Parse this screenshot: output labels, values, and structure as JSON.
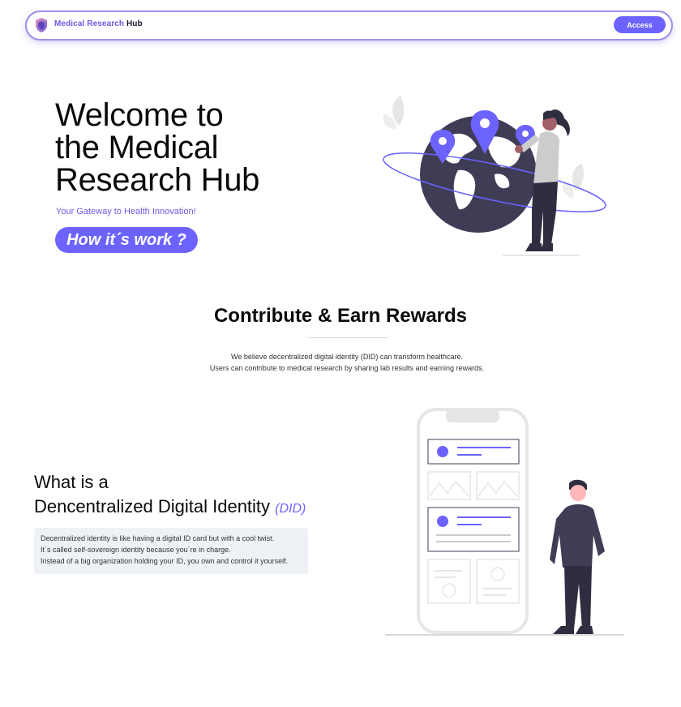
{
  "nav": {
    "brand_accent": "Medical Research",
    "brand_rest": " Hub",
    "access_label": "Access",
    "logo_icon": "shield-icon"
  },
  "hero": {
    "title_line1": "Welcome to",
    "title_line2": "the Medical",
    "title_line3": "Research Hub",
    "subtitle": "Your Gateway to Health Innovation!",
    "cta_label": "How it´s work ?",
    "illustration": "globe-with-map-pins-illustration"
  },
  "contribute": {
    "title": "Contribute & Earn Rewards",
    "line1": "We believe decentralized digital identity (DID) can transform healthcare.",
    "line2": "Users can contribute to medical research by sharing lab results and earning rewards."
  },
  "did": {
    "title_line1": "What is a",
    "title_line2": "Dencentralized Digital Identity",
    "tag": "(DID)",
    "text1": "Decentralized identity is like having a digital ID card but with a cool twist.",
    "text2": "It´s called self-sovereign identity because you´re in charge.",
    "text3": "Instead of a big organization holding your ID, you own and control it yourself.",
    "illustration": "phone-with-person-illustration"
  },
  "colors": {
    "accent": "#6c63ff",
    "dark": "#3f3d56",
    "box_bg": "#eef1f5"
  }
}
